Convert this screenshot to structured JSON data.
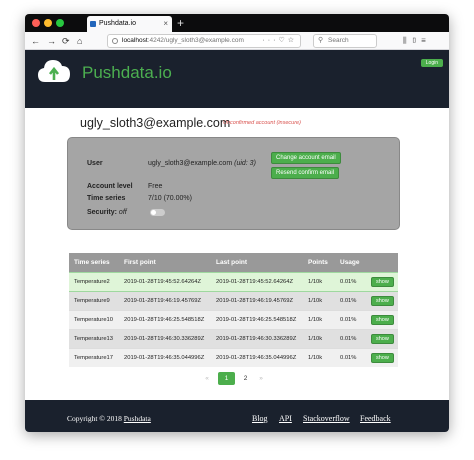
{
  "browser": {
    "tab_title": "Pushdata.io",
    "url_host": "localhost",
    "url_rest": ":4242/ugly_sloth3@example.com",
    "search_placeholder": "Search",
    "new_tab": "+",
    "close_tab": "×"
  },
  "header": {
    "brand": "Pushdata.io",
    "login_label": "Login"
  },
  "account": {
    "email_title": "ugly_sloth3@example.com",
    "unconfirmed": "Unconfirmed account (insecure)",
    "user_label": "User",
    "user_value": "ugly_sloth3@example.com",
    "uid": "(uid: 3)",
    "level_label": "Account level",
    "level_value": "Free",
    "series_label": "Time series",
    "series_value": "7/10 (70.00%)",
    "security_label": "Security:",
    "security_value": "off",
    "change_email_btn": "Change account email",
    "resend_btn": "Resend confirm email"
  },
  "table": {
    "headers": [
      "Time series",
      "First point",
      "Last point",
      "Points",
      "Usage",
      ""
    ],
    "show_label": "show",
    "rows": [
      {
        "name": "Temperature2",
        "first": "2019-01-28T19:45:52.64264Z",
        "last": "2019-01-28T19:45:52.64264Z",
        "points": "1/10k",
        "usage": "0.01%"
      },
      {
        "name": "Temperature9",
        "first": "2019-01-28T19:46:19.45769Z",
        "last": "2019-01-28T19:46:19.45769Z",
        "points": "1/10k",
        "usage": "0.01%"
      },
      {
        "name": "Temperature10",
        "first": "2019-01-28T19:46:25.548518Z",
        "last": "2019-01-28T19:46:25.548518Z",
        "points": "1/10k",
        "usage": "0.01%"
      },
      {
        "name": "Temperature13",
        "first": "2019-01-28T19:46:30.336289Z",
        "last": "2019-01-28T19:46:30.336289Z",
        "points": "1/10k",
        "usage": "0.01%"
      },
      {
        "name": "Temperature17",
        "first": "2019-01-28T19:46:35.044996Z",
        "last": "2019-01-28T19:46:35.044996Z",
        "points": "1/10k",
        "usage": "0.01%"
      }
    ]
  },
  "pagination": {
    "prev": "«",
    "next": "»",
    "pages": [
      "1",
      "2"
    ],
    "current": "1"
  },
  "footer": {
    "copyright": "Copyright © 2018",
    "brand_link": "Pushdata",
    "links": [
      "Blog",
      "API",
      "Stackoverflow",
      "Feedback"
    ]
  },
  "colors": {
    "accent_green": "#4cae4c",
    "header_bg": "#1a212d",
    "warning_red": "#d9534f"
  }
}
